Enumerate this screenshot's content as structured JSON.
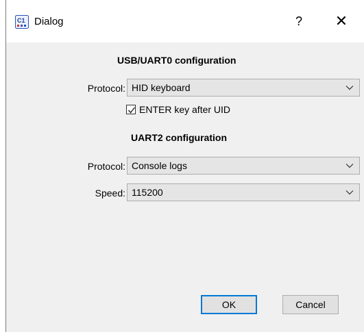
{
  "window": {
    "title": "Dialog",
    "help_glyph": "?",
    "close_glyph": "✕",
    "icon": "c1-app-icon"
  },
  "usb_section": {
    "heading": "USB/UART0 configuration",
    "protocol_label": "Protocol:",
    "protocol_value": "HID keyboard",
    "enter_checkbox": {
      "label": "ENTER key after UID",
      "checked": true
    }
  },
  "uart2_section": {
    "heading": "UART2 configuration",
    "protocol_label": "Protocol:",
    "protocol_value": "Console logs",
    "speed_label": "Speed:",
    "speed_value": "115200"
  },
  "buttons": {
    "ok": "OK",
    "cancel": "Cancel"
  },
  "colors": {
    "accent": "#0078d7",
    "panel": "#f0f0f0",
    "combo_bg": "#e5e5e5"
  }
}
